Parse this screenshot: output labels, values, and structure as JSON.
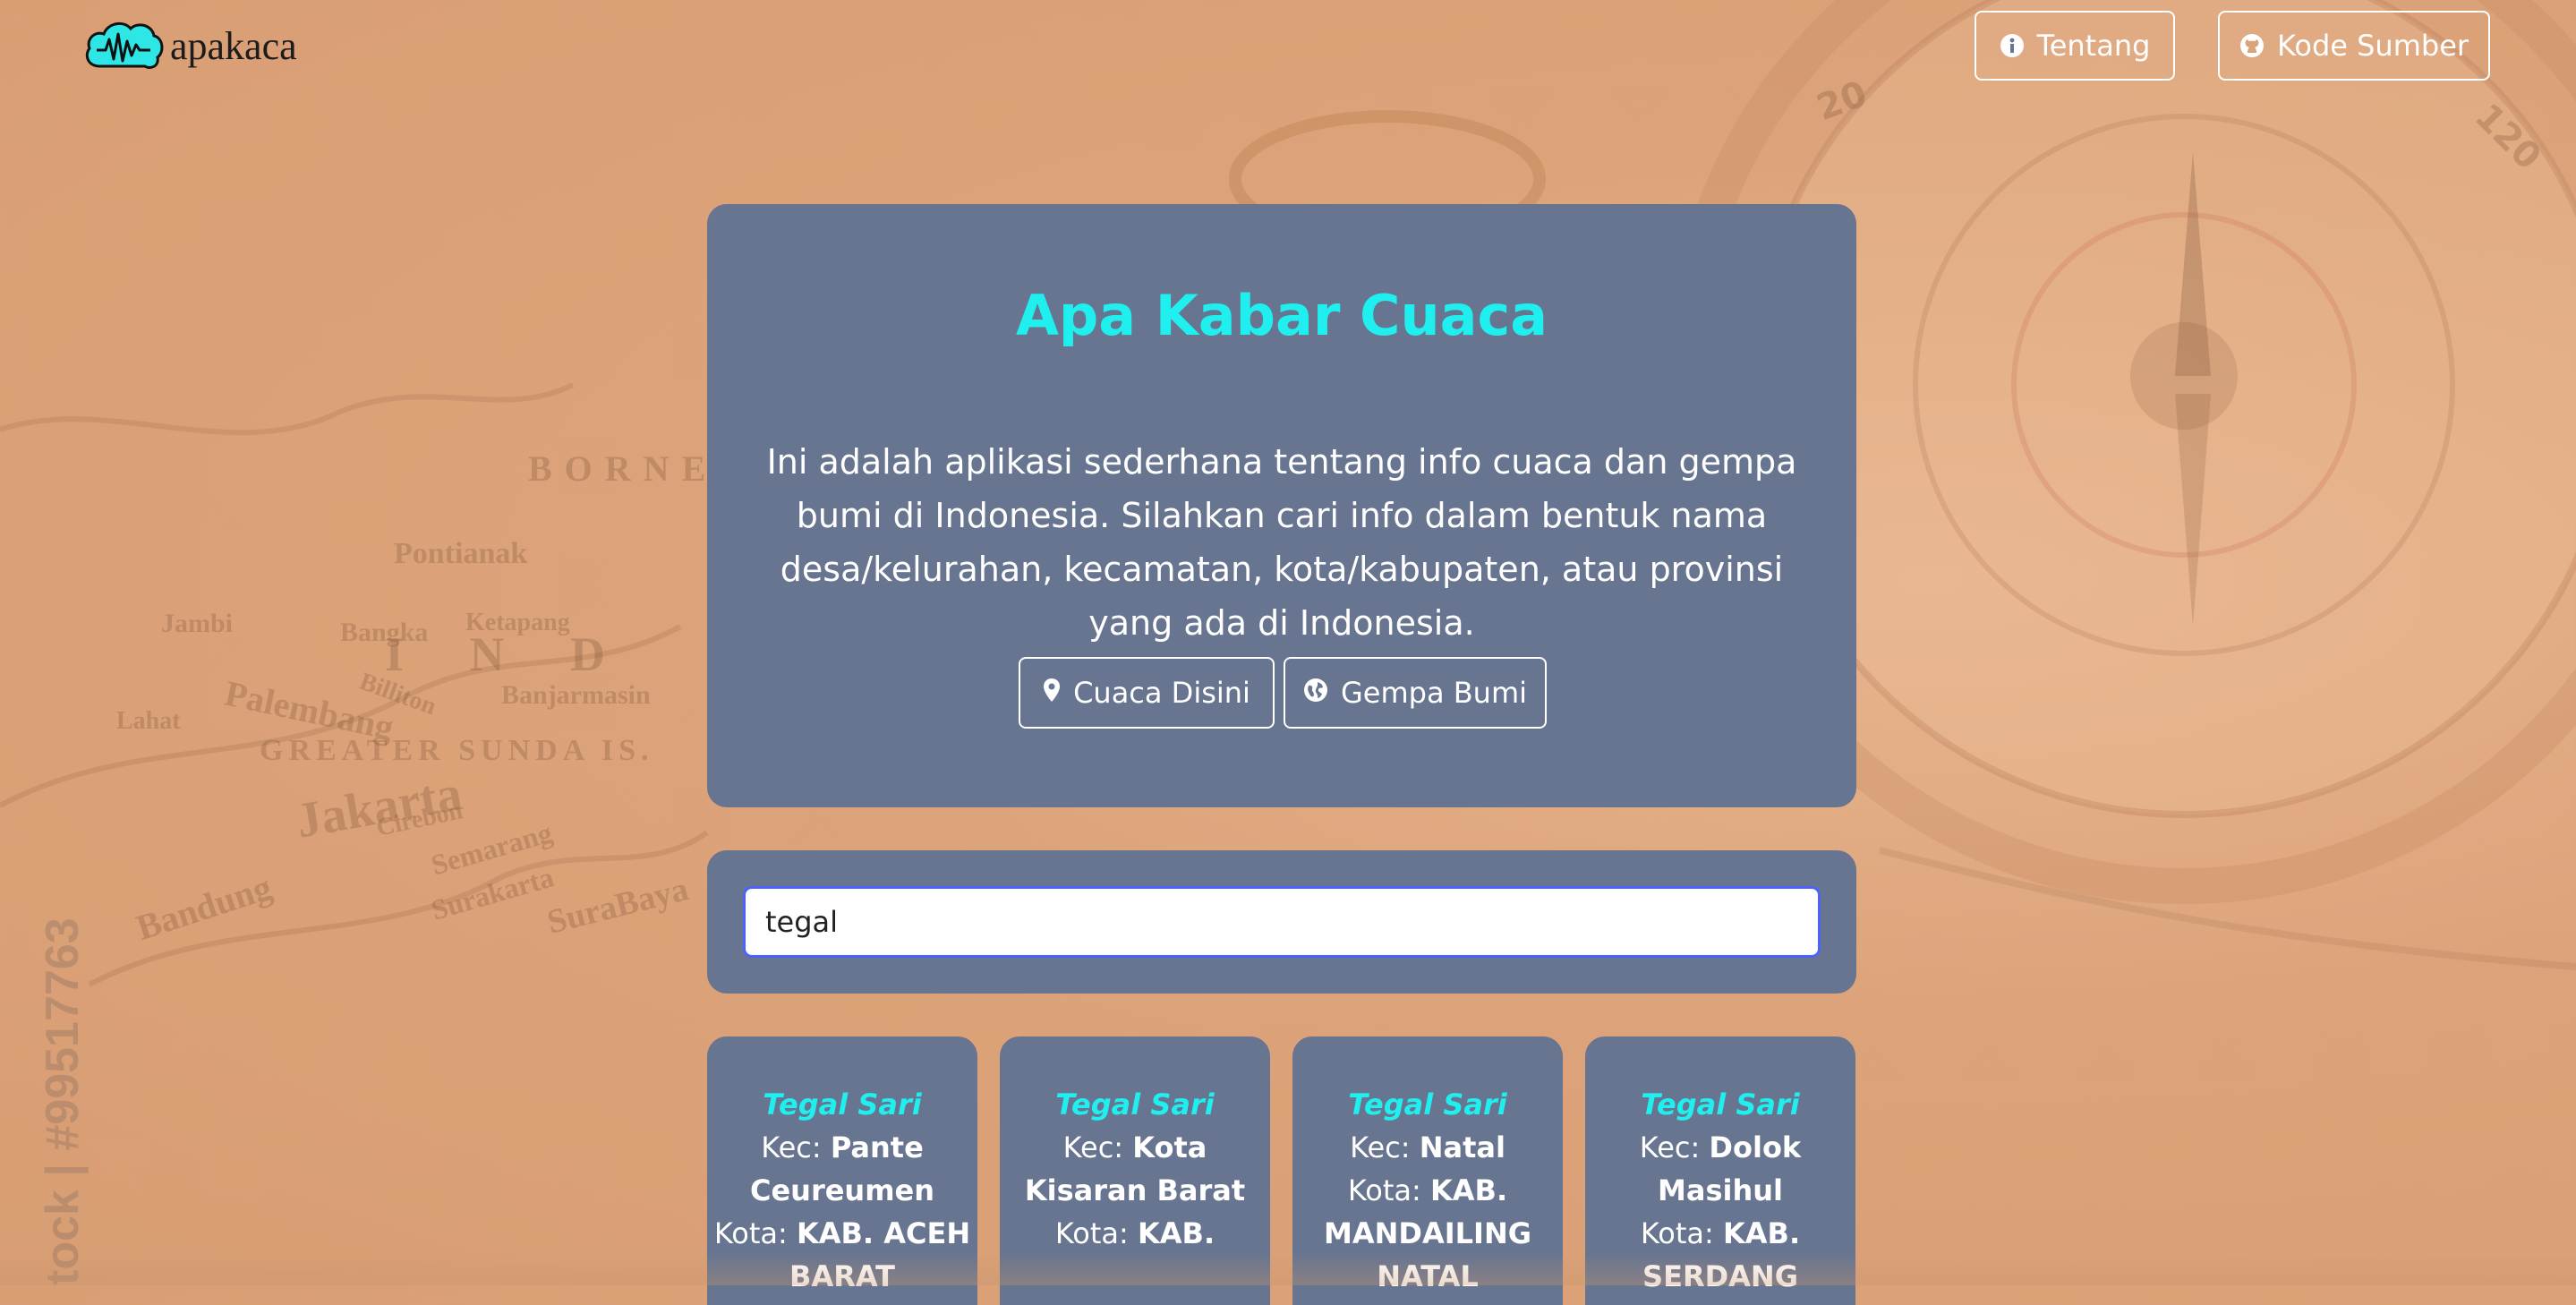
{
  "header": {
    "logo_text": "apakaca",
    "about_label": "Tentang",
    "source_label": "Kode Sumber"
  },
  "hero": {
    "title": "Apa Kabar Cuaca",
    "description": "Ini adalah aplikasi sederhana tentang info cuaca dan gempa bumi di Indonesia. Silahkan cari info dalam bentuk nama desa/kelurahan, kecamatan, kota/kabupaten, atau provinsi yang ada di Indonesia.",
    "weather_here_label": "Cuaca Disini",
    "earthquake_label": "Gempa Bumi"
  },
  "search": {
    "value": "tegal"
  },
  "results": {
    "kec_prefix": "Kec: ",
    "kota_prefix": "Kota: ",
    "items": [
      {
        "name": "Tegal Sari",
        "kecamatan": "Pante Ceureumen",
        "kota": "KAB. ACEH BARAT"
      },
      {
        "name": "Tegal Sari",
        "kecamatan": "Kota Kisaran Barat",
        "kota": "KAB."
      },
      {
        "name": "Tegal Sari",
        "kecamatan": "Natal",
        "kota": "KAB. MANDAILING NATAL"
      },
      {
        "name": "Tegal Sari",
        "kecamatan": "Dolok Masihul",
        "kota": "KAB. SERDANG"
      }
    ]
  },
  "background": {
    "map_labels": [
      "Pontianak",
      "Jambi",
      "Bangka",
      "Palembang",
      "GREATER SUNDA IS.",
      "Jakarta",
      "Bandung",
      "Semarang",
      "Surakarta",
      "SuraBaya",
      "Banjarmasin",
      "Ketapang",
      "Cirebon",
      "Lahat",
      "Billiton",
      "I N D",
      "BORNEO"
    ],
    "compass_numbers": [
      "20",
      "120"
    ],
    "watermark": "tock | #99517763"
  },
  "colors": {
    "accent": "#1ff0ef",
    "card": "#687590",
    "input_border": "#4b62ff"
  }
}
